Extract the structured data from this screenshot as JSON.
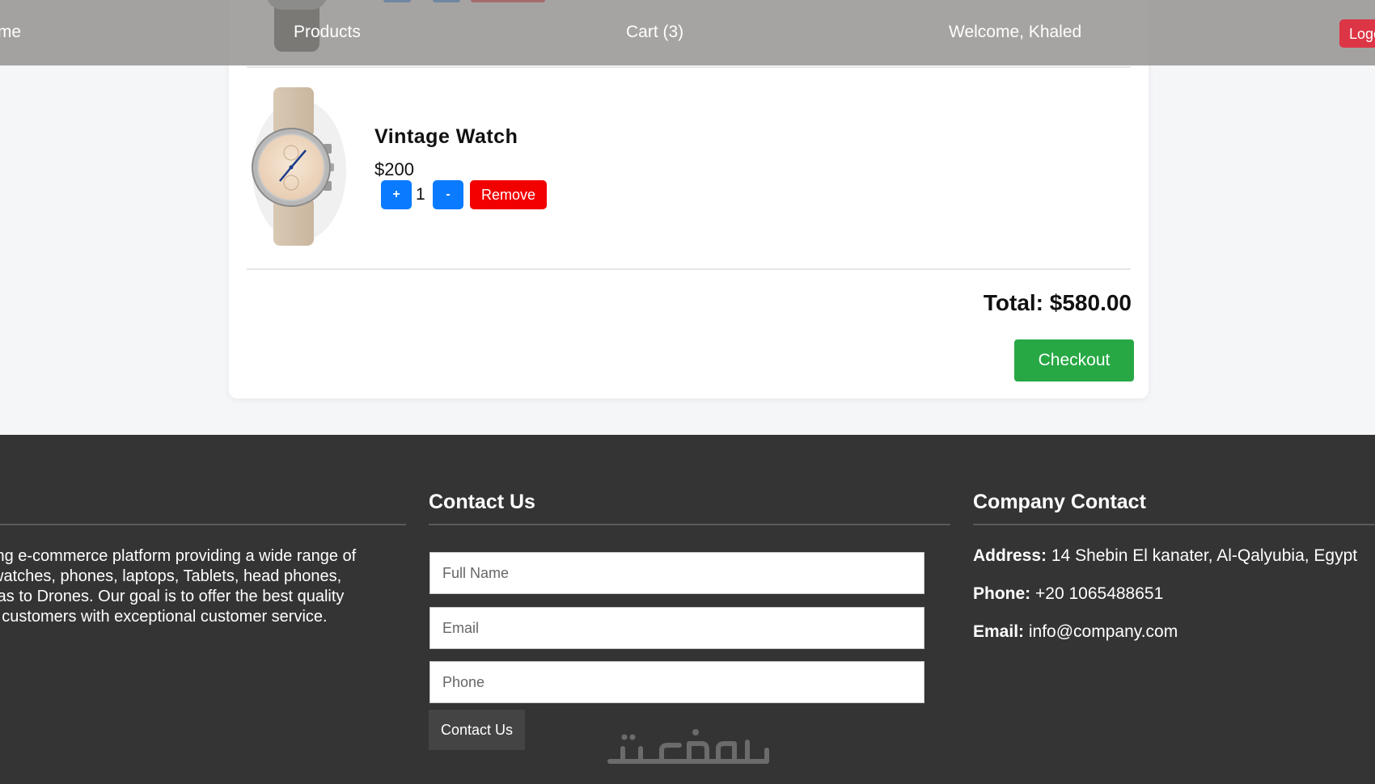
{
  "nav": {
    "home_label": "Home",
    "products_label": "Products",
    "cart_label": "Cart (3)",
    "welcome_label": "Welcome, Khaled",
    "logout_label": "Logout"
  },
  "cart": {
    "item": {
      "name": "Vintage Watch",
      "price": "$200",
      "quantity": "1",
      "plus_label": "+",
      "minus_label": "-",
      "remove_label": "Remove"
    },
    "total_label": "Total: $580.00",
    "checkout_label": "Checkout"
  },
  "footer": {
    "about_lines": [
      "ing e-commerce platform providing a wide range of",
      "watches, phones, laptops, Tablets, head phones,",
      "ras to Drones. Our goal is to offer the best quality",
      "r customers with exceptional customer service."
    ],
    "contact_heading": "Contact Us",
    "fullname_placeholder": "Full Name",
    "email_placeholder": "Email",
    "phone_placeholder": "Phone",
    "contact_button": "Contact Us",
    "company_heading": "Company Contact",
    "address_label": "Address:",
    "address_value": "14 Shebin El kanater, Al-Qalyubia, Egypt",
    "phone_label": "Phone:",
    "phone_value": "+20 1065488651",
    "email_label": "Email:",
    "email_value": "info@company.com"
  },
  "colors": {
    "primary_blue": "#0a7bff",
    "remove_red": "#f20000",
    "checkout_green": "#27a844",
    "logout_red": "#dc3545",
    "footer_bg": "#343434"
  }
}
